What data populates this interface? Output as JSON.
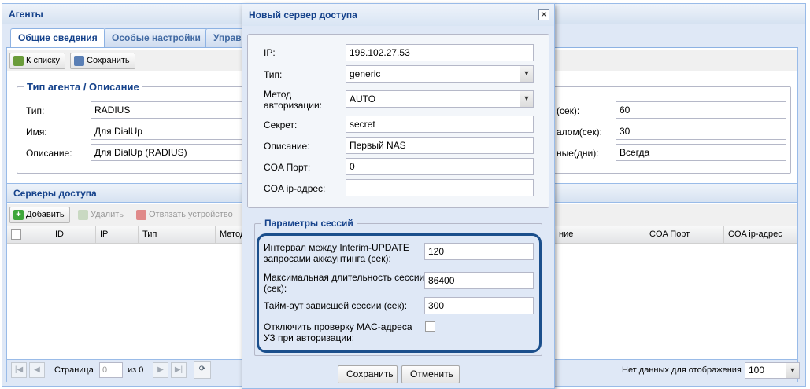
{
  "window": {
    "title": "Агенты"
  },
  "tabs": [
    {
      "label": "Общие сведения"
    },
    {
      "label": "Особые настройки"
    },
    {
      "label": "Управ"
    }
  ],
  "toolbar": {
    "back_label": "К списку",
    "save_label": "Сохранить"
  },
  "agent_section": {
    "legend": "Тип агента / Описание",
    "type_label": "Тип:",
    "type_value": "RADIUS",
    "name_label": "Имя:",
    "name_value": "Для DialUp",
    "desc_label": "Описание:",
    "desc_value": "Для DialUp (RADIUS)",
    "right_fields": [
      {
        "label": "(сек):",
        "value": "60"
      },
      {
        "label": "алом(сек):",
        "value": "30"
      },
      {
        "label": "ные(дни):",
        "value": "Всегда"
      }
    ]
  },
  "servers": {
    "title": "Серверы доступа",
    "add_label": "Добавить",
    "delete_label": "Удалить",
    "unbind_label": "Отвязать устройство",
    "columns": [
      "ID",
      "IP",
      "Тип",
      "Метод",
      "ние",
      "COA Порт",
      "COA ip-адрес"
    ]
  },
  "pager": {
    "page_label": "Страница",
    "page_value": "0",
    "of_label": "из 0",
    "empty_text": "Нет данных для отображения",
    "page_size": "100"
  },
  "dialog": {
    "title": "Новый сервер доступа",
    "close_icon": "✕",
    "ip_label": "IP:",
    "ip_value": "198.102.27.53",
    "type_label": "Тип:",
    "type_value": "generic",
    "method_label_1": "Метод",
    "method_label_2": "авторизации:",
    "method_value": "AUTO",
    "secret_label": "Секрет:",
    "secret_value": "secret",
    "desc_label": "Описание:",
    "desc_value": "Первый NAS",
    "coa_port_label": "COA Порт:",
    "coa_port_value": "0",
    "coa_ip_label": "COA ip-адрес:",
    "coa_ip_value": "",
    "session_legend": "Параметры сессий",
    "interim_label_1": "Интервал между Interim-UPDATE",
    "interim_label_2": "запросами аккаунтинга (сек):",
    "interim_value": "120",
    "maxdur_label_1": "Максимальная длительность сессии",
    "maxdur_label_2": "(сек):",
    "maxdur_value": "86400",
    "timeout_label": "Тайм-аут зависшей сессии (сек):",
    "timeout_value": "300",
    "mac_label_1": "Отключить проверку MAC-адреса",
    "mac_label_2": "УЗ при авторизации:",
    "save_label": "Сохранить",
    "cancel_label": "Отменить"
  },
  "colors": {
    "accent": "#15428b",
    "highlight": "#1b4f8c",
    "panel": "#dfe8f6"
  }
}
